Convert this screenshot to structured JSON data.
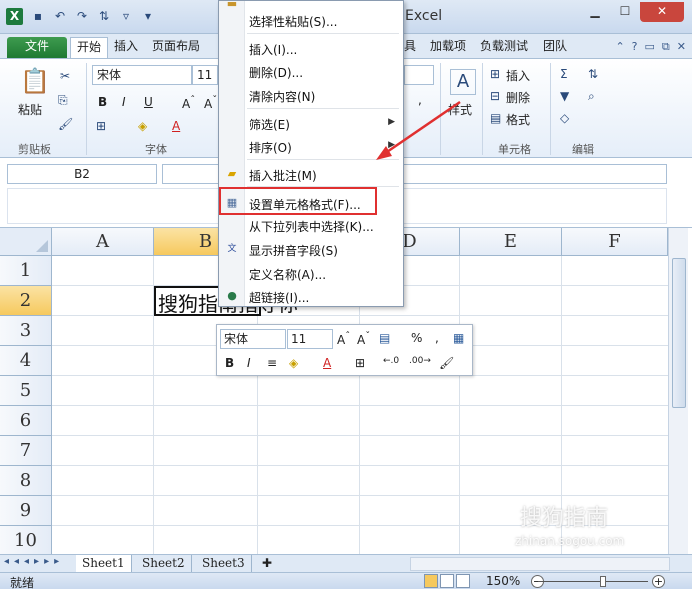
{
  "app": {
    "title": "Excel",
    "logo": "X"
  },
  "tabs": [
    {
      "label": "文件"
    },
    {
      "label": "开始"
    },
    {
      "label": "插入"
    },
    {
      "label": "页面布局"
    },
    {
      "label": "具"
    },
    {
      "label": "加载项"
    },
    {
      "label": "负载测试"
    },
    {
      "label": "团队"
    }
  ],
  "ribbon": {
    "paste_label": "粘贴",
    "font_name": "宋体",
    "font_size": "11",
    "bold": "B",
    "italic": "I",
    "underline": "U",
    "font_color_letter": "A",
    "clipboard_group": "剪贴板",
    "font_group": "字体",
    "style_label": "样式",
    "insert_label": "插入",
    "delete_label": "删除",
    "format_label": "格式",
    "cells_group": "单元格",
    "edit_group": "编辑",
    "comma": ","
  },
  "namebox": "B2",
  "columns": [
    "A",
    "B",
    "C",
    "D",
    "E",
    "F"
  ],
  "rows": [
    "1",
    "2",
    "3",
    "4",
    "5",
    "6",
    "7",
    "8",
    "9",
    "10"
  ],
  "cell_b2_text": "搜狗指南指导你",
  "context_menu": {
    "items": [
      {
        "label": "选择性粘贴(S)..."
      },
      {
        "label": "插入(I)..."
      },
      {
        "label": "删除(D)..."
      },
      {
        "label": "清除内容(N)"
      },
      {
        "label": "筛选(E)"
      },
      {
        "label": "排序(O)"
      },
      {
        "label": "插入批注(M)"
      },
      {
        "label": "设置单元格格式(F)..."
      },
      {
        "label": "从下拉列表中选择(K)..."
      },
      {
        "label": "显示拼音字段(S)"
      },
      {
        "label": "定义名称(A)..."
      },
      {
        "label": "超链接(I)..."
      }
    ]
  },
  "mini_toolbar": {
    "font_name": "宋体",
    "font_size": "11",
    "percent": "%",
    "comma": ",",
    "bold": "B",
    "italic": "I",
    "font_color_letter": "A"
  },
  "sheets": [
    {
      "label": "Sheet1"
    },
    {
      "label": "Sheet2"
    },
    {
      "label": "Sheet3"
    }
  ],
  "status": {
    "ready": "就绪",
    "zoom": "150%"
  },
  "watermark": {
    "brand": "搜狗指南",
    "url": "zhinan.sogou.com"
  },
  "colors": {
    "file_tab": "#1f7a33",
    "highlight": "#e03030",
    "selected_header": "#f6c95e"
  }
}
